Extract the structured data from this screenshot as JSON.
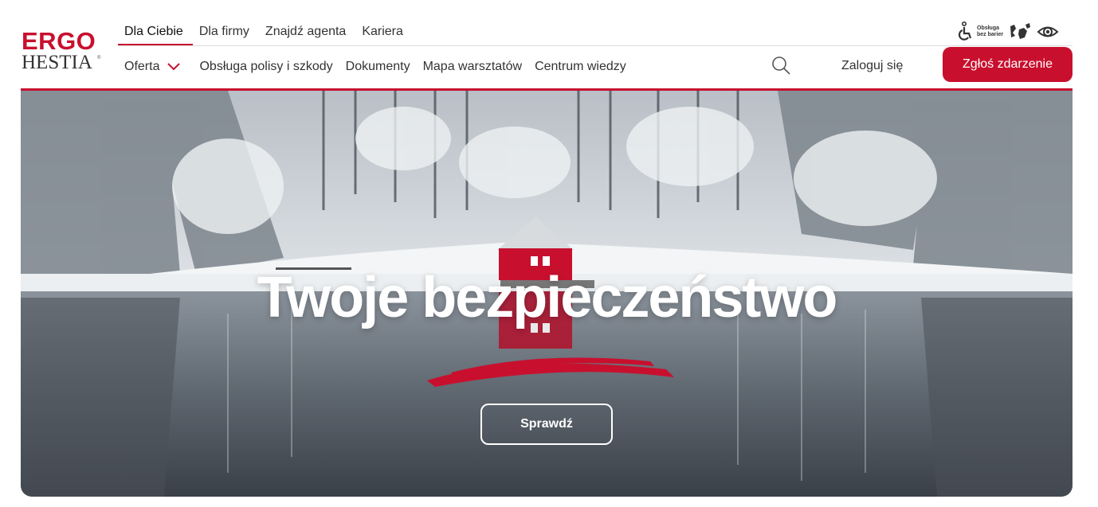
{
  "brand": {
    "line1": "ERGO",
    "line2": "HESTIA",
    "reg": "®"
  },
  "top_nav": [
    {
      "label": "Dla Ciebie",
      "active": true
    },
    {
      "label": "Dla firmy"
    },
    {
      "label": "Znajdź agenta"
    },
    {
      "label": "Kariera"
    }
  ],
  "accessibility": {
    "barrier_free_line1": "Obsługa",
    "barrier_free_line2": "bez barier",
    "icons": [
      "wheelchair-icon",
      "sign-language-icon",
      "eye-icon"
    ]
  },
  "sub_nav": {
    "offer_label": "Oferta",
    "items": [
      "Obsługa polisy i szkody",
      "Dokumenty",
      "Mapa warsztatów",
      "Centrum wiedzy"
    ]
  },
  "header_actions": {
    "login_label": "Zaloguj się",
    "report_label": "Zgłoś zdarzenie"
  },
  "hero": {
    "title": "Twoje bezpieczeństwo",
    "cta_label": "Sprawdź"
  },
  "colors": {
    "brand_red": "#c8102e",
    "text": "#333333"
  }
}
